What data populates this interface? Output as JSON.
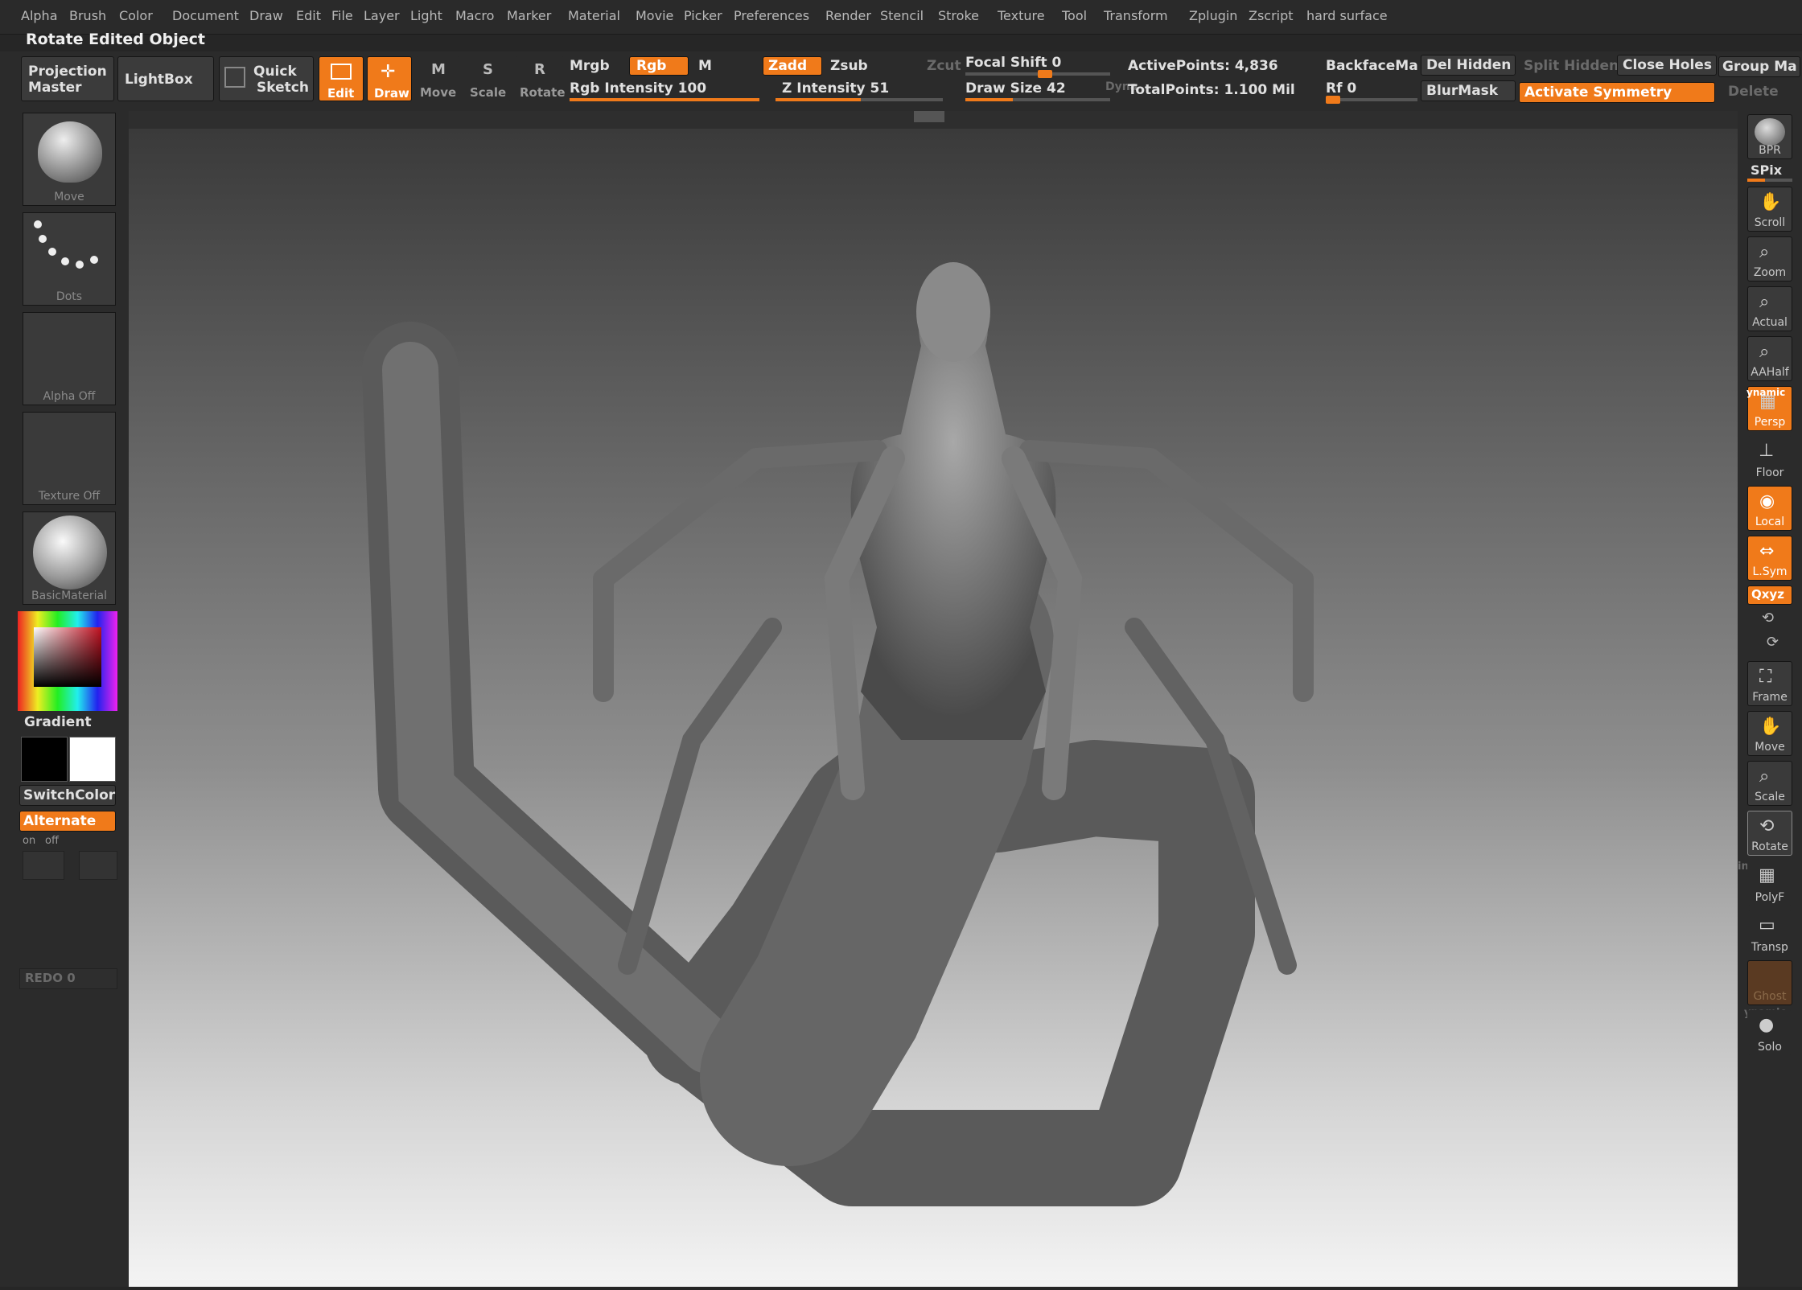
{
  "menu": [
    "Alpha",
    "Brush",
    "Color",
    "Document",
    "Draw",
    "Edit",
    "File",
    "Layer",
    "Light",
    "Macro",
    "Marker",
    "Material",
    "Movie",
    "Picker",
    "Preferences",
    "Render",
    "Stencil",
    "Stroke",
    "Texture",
    "Tool",
    "Transform",
    "Zplugin",
    "Zscript",
    "hard surface"
  ],
  "status": "Rotate Edited Object",
  "shelf": {
    "projection_master_1": "Projection",
    "projection_master_2": "Master",
    "lightbox": "LightBox",
    "quick_sketch_1": "Quick",
    "quick_sketch_2": "Sketch",
    "edit": "Edit",
    "draw": "Draw",
    "move": "Move",
    "scale": "Scale",
    "rotate": "Rotate",
    "mrgb": "Mrgb",
    "rgb": "Rgb",
    "m": "M",
    "rgb_intensity": "Rgb Intensity 100",
    "zadd": "Zadd",
    "zsub": "Zsub",
    "zcut": "Zcut",
    "z_intensity": "Z Intensity 51",
    "focal_shift": "Focal Shift 0",
    "draw_size": "Draw Size 42",
    "dynamic": "Dyna",
    "active_points": "ActivePoints: 4,836",
    "total_points": "TotalPoints: 1.100 Mil",
    "backface": "BackfaceMa",
    "rf": "Rf 0",
    "del_hidden": "Del Hidden",
    "blurmask": "BlurMask",
    "split_hidden": "Split Hidden",
    "close_holes": "Close Holes",
    "group_ma": "Group Ma",
    "activate_symmetry": "Activate Symmetry",
    "delete": "Delete"
  },
  "left": {
    "brush": "Move",
    "stroke": "Dots",
    "alpha": "Alpha Off",
    "texture": "Texture Off",
    "material": "BasicMaterial",
    "gradient": "Gradient",
    "switchcolor": "SwitchColor",
    "alternate": "Alternate",
    "on": "on",
    "off": "off",
    "redo": "REDO 0"
  },
  "right": {
    "bpr": "BPR",
    "spix": "SPix",
    "scroll": "Scroll",
    "zoom": "Zoom",
    "actual": "Actual",
    "aahalf": "AAHalf",
    "dynamic": "ynamic",
    "persp": "Persp",
    "floor": "Floor",
    "local": "Local",
    "lsym": "L.Sym",
    "xyz": "Qxyz",
    "frame": "Frame",
    "move": "Move",
    "scale": "Scale",
    "rotate": "Rotate",
    "linefill": "ine Fill",
    "polyf": "PolyF",
    "transp": "Transp",
    "ghost": "Ghost",
    "dynamic2": "ynamic",
    "solo": "Solo"
  },
  "colors": {
    "accent": "#f07a1a",
    "panel": "#2b2b2b",
    "button": "#3b3b3b"
  },
  "sliders": {
    "rgb_intensity": 100,
    "z_intensity": 51,
    "focal_shift": 0,
    "draw_size": 42
  }
}
